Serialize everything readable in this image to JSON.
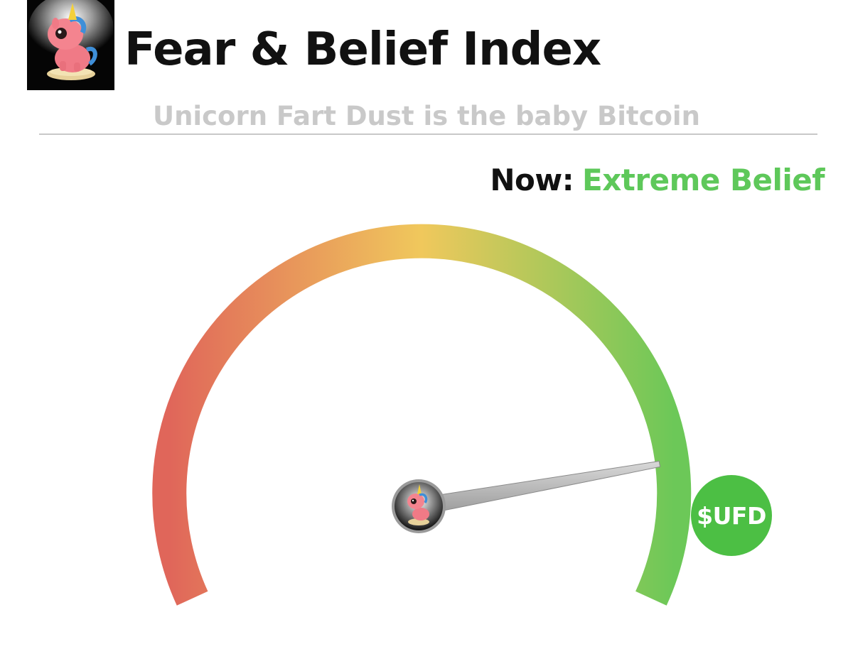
{
  "header": {
    "title": "Fear & Belief Index",
    "subtitle": "Unicorn Fart Dust is the baby Bitcoin"
  },
  "status": {
    "label": "Now:",
    "value": "Extreme Belief"
  },
  "gauge": {
    "needle_level": 0.87,
    "colors": {
      "fear": "#e0665a",
      "neutral": "#f0c85c",
      "belief": "#6cc858"
    }
  },
  "badge": {
    "ticker": "$UFD",
    "color": "#4cbf44"
  },
  "icons": {
    "logo": "unicorn-mascot-icon",
    "needle_hub": "unicorn-mascot-icon"
  }
}
